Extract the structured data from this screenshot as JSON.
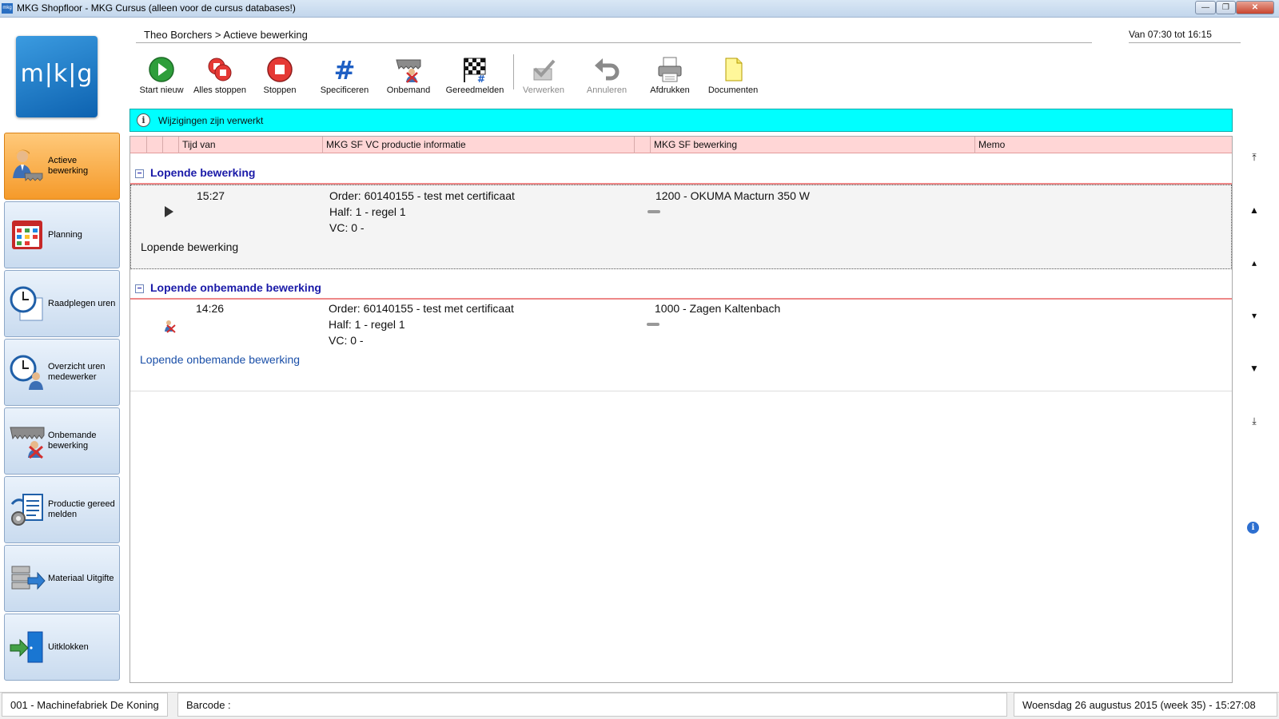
{
  "window": {
    "title": "MKG Shopfloor - MKG Cursus (alleen voor de cursus databases!)",
    "app_icon": "mkg",
    "controls": [
      "minimize",
      "maximize",
      "close"
    ]
  },
  "logo": {
    "text": "m|k|g"
  },
  "breadcrumb": "Theo Borchers > Actieve bewerking",
  "shift_time": "Van 07:30 tot 16:15",
  "toolbar": [
    {
      "label": "Start nieuw",
      "icon": "play-green-icon",
      "enabled": true
    },
    {
      "label": "Alles stoppen",
      "icon": "stop-all-icon",
      "enabled": true
    },
    {
      "label": "Stoppen",
      "icon": "stop-icon",
      "enabled": true
    },
    {
      "label": "Specificeren",
      "icon": "hash-icon",
      "enabled": true
    },
    {
      "label": "Onbemand",
      "icon": "unmanned-icon",
      "enabled": true
    },
    {
      "label": "Gereedmelden",
      "icon": "checkered-flag-icon",
      "enabled": true
    },
    {
      "label": "Verwerken",
      "icon": "process-check-icon",
      "enabled": false
    },
    {
      "label": "Annuleren",
      "icon": "undo-icon",
      "enabled": false
    },
    {
      "label": "Afdrukken",
      "icon": "printer-icon",
      "enabled": true
    },
    {
      "label": "Documenten",
      "icon": "document-icon",
      "enabled": true
    }
  ],
  "sidebar": [
    {
      "label": "Actieve bewerking",
      "icon": "worker-icon",
      "active": true
    },
    {
      "label": "Planning",
      "icon": "calendar-icon",
      "active": false
    },
    {
      "label": "Raadplegen uren",
      "icon": "clock-icon",
      "active": false
    },
    {
      "label": "Overzicht uren medewerker",
      "icon": "clock-person-icon",
      "active": false
    },
    {
      "label": "Onbemande bewerking",
      "icon": "unmanned-machine-icon",
      "active": false
    },
    {
      "label": "Productie gereed melden",
      "icon": "production-ready-icon",
      "active": false
    },
    {
      "label": "Materiaal Uitgifte",
      "icon": "material-issue-icon",
      "active": false
    },
    {
      "label": "Uitklokken",
      "icon": "clock-out-icon",
      "active": false
    }
  ],
  "banner": {
    "text": "Wijzigingen zijn verwerkt"
  },
  "grid": {
    "columns": [
      "Tijd van",
      "MKG SF VC productie informatie",
      "MKG SF bewerking",
      "Memo"
    ],
    "groups": [
      {
        "title": "Lopende bewerking",
        "rows": [
          {
            "time": "15:27",
            "order": "Order: 60140155 - test met certificaat",
            "half": "Half: 1 - regel 1",
            "vc": "VC: 0 -",
            "operation": "1200 - OKUMA Macturn 350 W",
            "memo": "Lopende bewerking"
          }
        ]
      },
      {
        "title": "Lopende onbemande bewerking",
        "rows": [
          {
            "time": "14:26",
            "order": "Order: 60140155 - test met certificaat",
            "half": "Half: 1 - regel 1",
            "vc": "VC: 0 -",
            "operation": "1000 - Zagen Kaltenbach",
            "memo": "Lopende onbemande bewerking"
          }
        ]
      }
    ]
  },
  "right_nav": [
    "first",
    "page-up",
    "up",
    "down",
    "page-down",
    "last"
  ],
  "status_bar": {
    "company": "001 - Machinefabriek De Koning",
    "barcode_label": "Barcode :",
    "datetime": "Woensdag 26 augustus 2015 (week 35) - 15:27:08"
  },
  "colors": {
    "banner": "#00ffff",
    "active_nav": "#f59a2a",
    "grid_header": "#ffd6d6",
    "group_title": "#1a1aa8"
  }
}
